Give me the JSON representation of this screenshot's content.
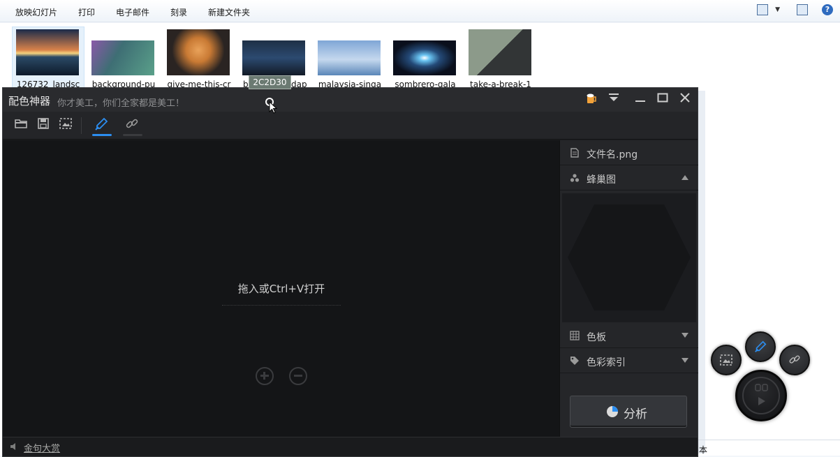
{
  "explorer": {
    "menu": [
      "放映幻灯片",
      "打印",
      "电子邮件",
      "刻录",
      "新建文件夹"
    ],
    "files": [
      {
        "label": "126732_landsc",
        "color": "#f3b86c"
      },
      {
        "label": "background-pu",
        "color": "#5e8a86"
      },
      {
        "label": "give-me-this-cr",
        "color": "#e08e45"
      },
      {
        "label": "b",
        "suffix": "dap",
        "color": "#223a5e"
      },
      {
        "label": "malaysia-singa",
        "color": "#8fb5df"
      },
      {
        "label": "sombrero-gala",
        "color": "#4aa7e0"
      },
      {
        "label": "take-a-break-1",
        "color": "#7a837a"
      }
    ],
    "status_text": "本"
  },
  "tooltip": {
    "text": "2C2D30"
  },
  "app": {
    "title": "配色神器",
    "slogan": "你才美工，你们全家都是美工！",
    "canvas": {
      "drop_text": "拖入或Ctrl+V打开"
    },
    "sidebar": {
      "filename": "文件名.png",
      "honeycomb": "蜂巢图",
      "palette": "色板",
      "color_index": "色彩索引",
      "analyze": "分析"
    },
    "status": {
      "link": "金句大赏"
    },
    "accent": "#2c8ef0"
  }
}
